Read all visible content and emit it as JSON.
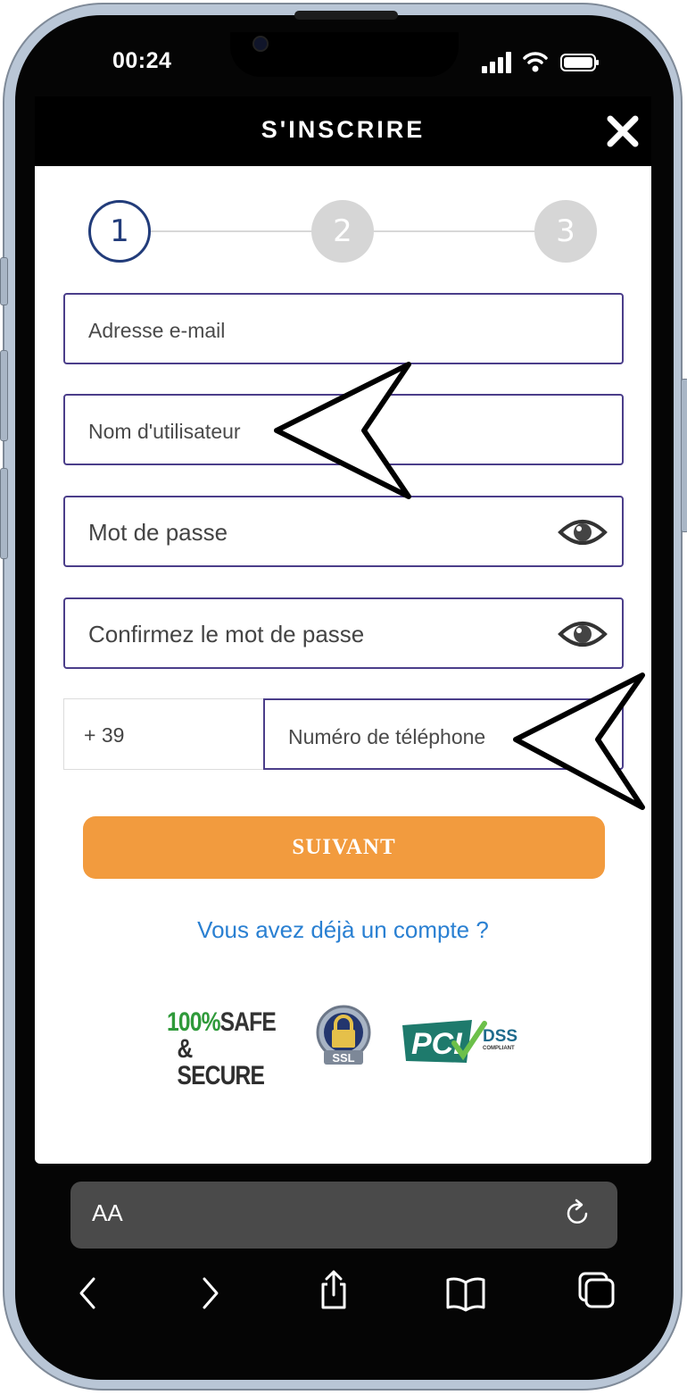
{
  "status_bar": {
    "time": "00:24",
    "icons": [
      "signal-icon",
      "wifi-icon",
      "battery-icon"
    ]
  },
  "header": {
    "title": "S'INSCRIRE",
    "close_icon": "close-icon"
  },
  "stepper": {
    "steps": [
      "1",
      "2",
      "3"
    ],
    "current_step": 1
  },
  "form": {
    "email_placeholder": "Adresse e-mail",
    "username_placeholder": "Nom d'utilisateur",
    "password_placeholder": "Mot de passe",
    "confirm_password_placeholder": "Confirmez le mot de passe",
    "country_code": "+ 39",
    "phone_placeholder": "Numéro de téléphone",
    "submit_label": "SUIVANT"
  },
  "login_link": "Vous avez déjà un compte ?",
  "badges": {
    "safe_line1_a": "100%",
    "safe_line1_b": "SAFE",
    "safe_line2": "& SECURE",
    "ssl": "SSL",
    "pci": "PCI",
    "dss": "DSS",
    "compliant": "COMPLIANT"
  },
  "browser": {
    "text_size_label": "AA"
  },
  "colors": {
    "accent": "#f29b3e",
    "link": "#2a80d2",
    "field_border": "#4b3e8a",
    "step_active": "#223c7a"
  }
}
